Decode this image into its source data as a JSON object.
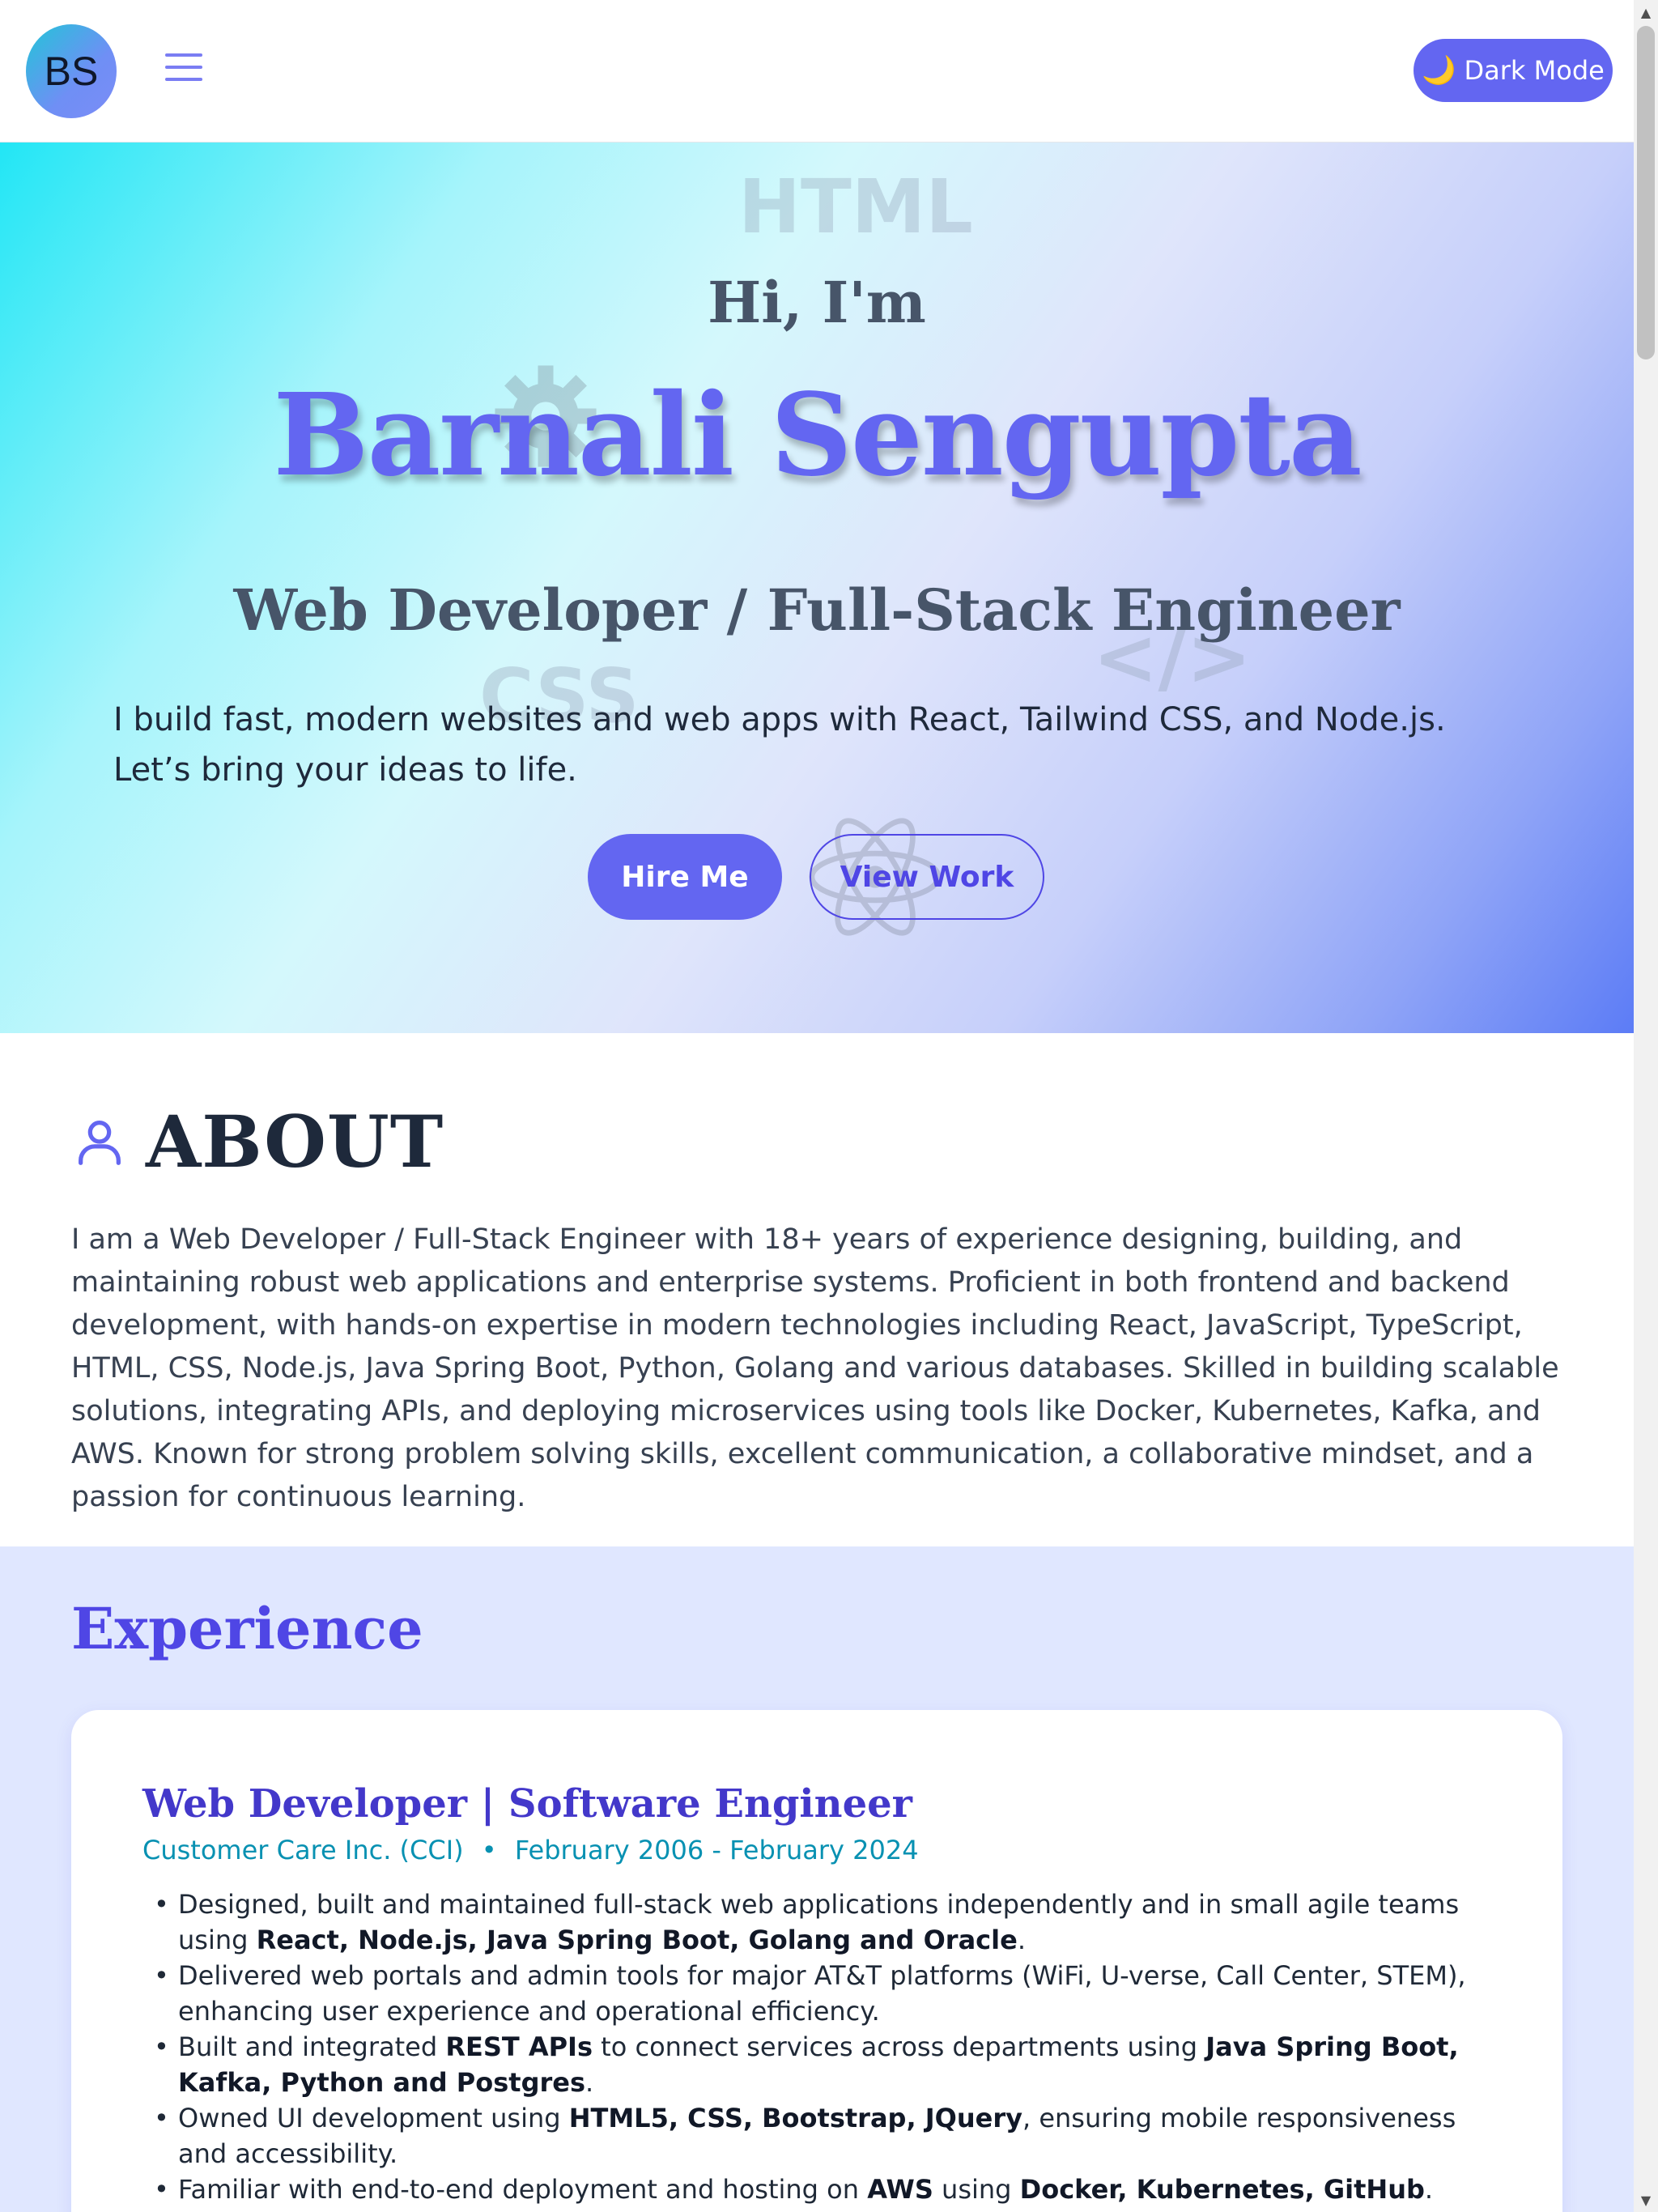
{
  "header": {
    "logo_initials": "BS",
    "menu_icon": "hamburger-menu-icon",
    "dark_mode_icon": "moon-icon",
    "dark_mode_label": "Dark Mode"
  },
  "hero": {
    "greeting": "Hi, I'm",
    "name": "Barnali Sengupta",
    "role": "Web Developer / Full-Stack Engineer",
    "description": "I build fast, modern websites and web apps with React, Tailwind CSS, and Node.js. Let’s bring your ideas to life.",
    "hire_label": "Hire Me",
    "view_work_label": "View Work",
    "background_words": [
      "HTML",
      "CSS",
      "</>"
    ],
    "background_icons": [
      "gear-icon",
      "react-atom-icon"
    ]
  },
  "about": {
    "icon": "user-icon",
    "title": "ABOUT",
    "text": "I am a Web Developer / Full-Stack Engineer with 18+ years of experience designing, building, and maintaining robust web applications and enterprise systems. Proficient in both frontend and backend development, with hands-on expertise in modern technologies including React, JavaScript, TypeScript, HTML, CSS, Node.js, Java Spring Boot, Python, Golang and various databases. Skilled in building scalable solutions, integrating APIs, and deploying microservices using tools like Docker, Kubernetes, Kafka, and AWS. Known for strong problem solving skills, excellent communication, a collaborative mindset, and a passion for continuous learning."
  },
  "experience": {
    "title": "Experience",
    "jobs": [
      {
        "title": "Web Developer | Software Engineer",
        "company": "Customer Care Inc. (CCI)",
        "separator": "•",
        "dates": "February 2006 - February 2024",
        "bullets": [
          [
            {
              "t": "Designed, built and maintained full-stack web applications independently and in small agile teams using "
            },
            {
              "t": "React, Node.js, Java Spring Boot, Golang and Oracle",
              "b": true
            },
            {
              "t": "."
            }
          ],
          [
            {
              "t": "Delivered web portals and admin tools for major AT&T platforms (WiFi, U-verse, Call Center, STEM), enhancing user experience and operational efficiency."
            }
          ],
          [
            {
              "t": "Built and integrated "
            },
            {
              "t": "REST APIs",
              "b": true
            },
            {
              "t": " to connect services across departments using "
            },
            {
              "t": "Java Spring Boot, Kafka, Python and Postgres",
              "b": true
            },
            {
              "t": "."
            }
          ],
          [
            {
              "t": "Owned UI development using "
            },
            {
              "t": "HTML5, CSS, Bootstrap, JQuery",
              "b": true
            },
            {
              "t": ", ensuring mobile responsiveness and accessibility."
            }
          ],
          [
            {
              "t": "Familiar with end-to-end deployment and hosting on "
            },
            {
              "t": "AWS",
              "b": true
            },
            {
              "t": " using "
            },
            {
              "t": "Docker, Kubernetes, GitHub",
              "b": true
            },
            {
              "t": "."
            }
          ]
        ]
      }
    ]
  },
  "colors": {
    "accent": "#6366f1",
    "accent_dark": "#4f46e5",
    "cyan": "#0891b2",
    "section_bg": "#e0e7ff"
  }
}
